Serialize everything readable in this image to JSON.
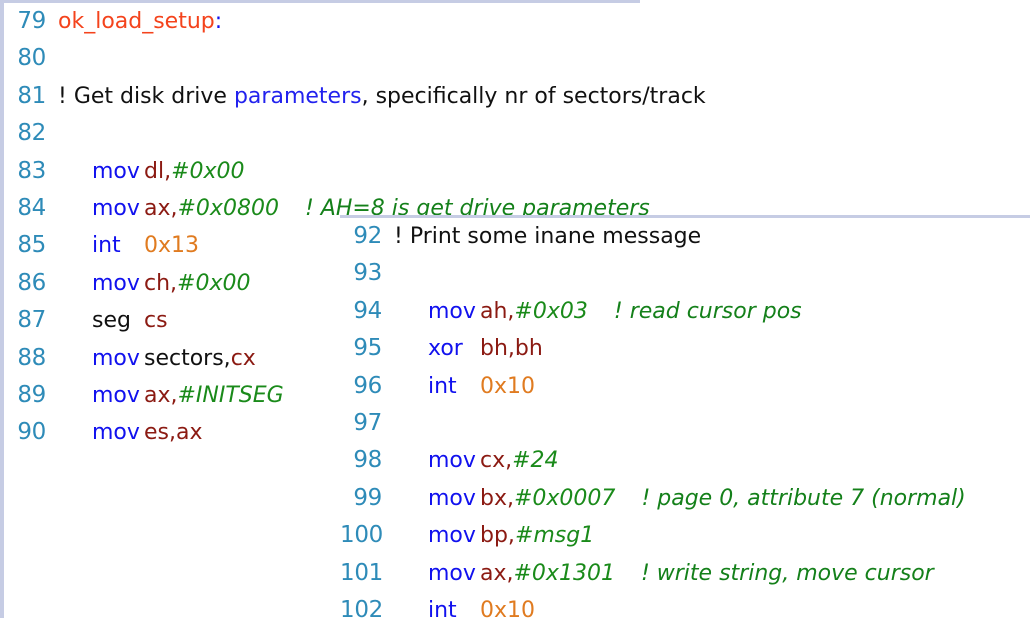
{
  "document": {
    "kind": "source-code-listing",
    "language": "x86 assembly (as86 / Linux bootsect.S)",
    "panel_count": 2
  },
  "colors": {
    "background": "#ffffff",
    "panel_border": "#c6cce4",
    "line_number": "#2E8BB8",
    "label": "#F4431C",
    "mnemonic": "#1111EE",
    "register": "#8B1A12",
    "immediate": "#1A8A1A",
    "hex_literal": "#E07B20",
    "comment": "#14801A",
    "plain_text": "#111111"
  },
  "panels": [
    {
      "id": "left",
      "name": "code-panel-left",
      "first_line": 79,
      "last_line": 90,
      "lines": [
        {
          "number": "79",
          "indent": false,
          "tokens": [
            {
              "text": "ok_load_setup",
              "type": "label"
            },
            {
              "text": ":",
              "type": "punct"
            }
          ]
        },
        {
          "number": "80",
          "indent": false,
          "tokens": []
        },
        {
          "number": "81",
          "indent": false,
          "tokens": [
            {
              "text": "! Get disk drive ",
              "type": "plain"
            },
            {
              "text": "parameters",
              "type": "keyword"
            },
            {
              "text": ", specifically nr of sectors/track",
              "type": "plain"
            }
          ]
        },
        {
          "number": "82",
          "indent": false,
          "tokens": []
        },
        {
          "number": "83",
          "indent": true,
          "tokens": [
            {
              "text": "mov",
              "type": "mnemonic-col"
            },
            {
              "text": "dl,",
              "type": "register"
            },
            {
              "text": "#0x00",
              "type": "immediate"
            }
          ]
        },
        {
          "number": "84",
          "indent": true,
          "tokens": [
            {
              "text": "mov",
              "type": "mnemonic-col"
            },
            {
              "text": "ax,",
              "type": "register"
            },
            {
              "text": "#0x0800",
              "type": "immediate"
            },
            {
              "text": "gap-md",
              "type": "gap"
            },
            {
              "text": "! AH=8 is get drive parameters",
              "type": "comment"
            }
          ]
        },
        {
          "number": "85",
          "indent": true,
          "tokens": [
            {
              "text": "int",
              "type": "mnemonic-col"
            },
            {
              "text": "0x13",
              "type": "hex"
            }
          ]
        },
        {
          "number": "86",
          "indent": true,
          "tokens": [
            {
              "text": "mov",
              "type": "mnemonic-col"
            },
            {
              "text": "ch,",
              "type": "register"
            },
            {
              "text": "#0x00",
              "type": "immediate"
            }
          ]
        },
        {
          "number": "87",
          "indent": true,
          "tokens": [
            {
              "text": "seg",
              "type": "plain-col"
            },
            {
              "text": "cs",
              "type": "register"
            }
          ]
        },
        {
          "number": "88",
          "indent": true,
          "tokens": [
            {
              "text": "mov",
              "type": "mnemonic-col"
            },
            {
              "text": "sectors,",
              "type": "plain"
            },
            {
              "text": "cx",
              "type": "register"
            }
          ]
        },
        {
          "number": "89",
          "indent": true,
          "tokens": [
            {
              "text": "mov",
              "type": "mnemonic-col"
            },
            {
              "text": "ax,",
              "type": "register"
            },
            {
              "text": "#INITSEG",
              "type": "immediate"
            }
          ]
        },
        {
          "number": "90",
          "indent": true,
          "tokens": [
            {
              "text": "mov",
              "type": "mnemonic-col"
            },
            {
              "text": "es,",
              "type": "register"
            },
            {
              "text": "ax",
              "type": "register"
            }
          ]
        }
      ]
    },
    {
      "id": "right",
      "name": "code-panel-right",
      "first_line": 92,
      "last_line": 102,
      "lines": [
        {
          "number": "92",
          "indent": false,
          "tokens": [
            {
              "text": "! Print some inane message",
              "type": "plain"
            }
          ]
        },
        {
          "number": "93",
          "indent": false,
          "tokens": []
        },
        {
          "number": "94",
          "indent": true,
          "tokens": [
            {
              "text": "mov",
              "type": "mnemonic-col"
            },
            {
              "text": "ah,",
              "type": "register"
            },
            {
              "text": "#0x03",
              "type": "immediate"
            },
            {
              "text": "gap-md",
              "type": "gap"
            },
            {
              "text": "! read cursor pos",
              "type": "comment"
            }
          ]
        },
        {
          "number": "95",
          "indent": true,
          "tokens": [
            {
              "text": "xor",
              "type": "mnemonic-col"
            },
            {
              "text": "bh,bh",
              "type": "register"
            }
          ]
        },
        {
          "number": "96",
          "indent": true,
          "tokens": [
            {
              "text": "int",
              "type": "mnemonic-col"
            },
            {
              "text": "0x10",
              "type": "hex"
            }
          ]
        },
        {
          "number": "97",
          "indent": false,
          "tokens": []
        },
        {
          "number": "98",
          "indent": true,
          "tokens": [
            {
              "text": "mov",
              "type": "mnemonic-col"
            },
            {
              "text": "cx,",
              "type": "register"
            },
            {
              "text": "#24",
              "type": "immediate"
            }
          ]
        },
        {
          "number": "99",
          "indent": true,
          "tokens": [
            {
              "text": "mov",
              "type": "mnemonic-col"
            },
            {
              "text": "bx,",
              "type": "register"
            },
            {
              "text": "#0x0007",
              "type": "immediate"
            },
            {
              "text": "gap-md",
              "type": "gap"
            },
            {
              "text": "! page 0, attribute 7 (normal)",
              "type": "comment"
            }
          ]
        },
        {
          "number": "100",
          "indent": true,
          "tokens": [
            {
              "text": "mov",
              "type": "mnemonic-col"
            },
            {
              "text": "bp,",
              "type": "register"
            },
            {
              "text": "#msg1",
              "type": "immediate"
            }
          ]
        },
        {
          "number": "101",
          "indent": true,
          "tokens": [
            {
              "text": "mov",
              "type": "mnemonic-col"
            },
            {
              "text": "ax,",
              "type": "register"
            },
            {
              "text": "#0x1301",
              "type": "immediate"
            },
            {
              "text": "gap-md",
              "type": "gap"
            },
            {
              "text": "! write string, move cursor",
              "type": "comment"
            }
          ]
        },
        {
          "number": "102",
          "indent": true,
          "tokens": [
            {
              "text": "int",
              "type": "mnemonic-col"
            },
            {
              "text": "0x10",
              "type": "hex"
            }
          ]
        }
      ]
    }
  ]
}
